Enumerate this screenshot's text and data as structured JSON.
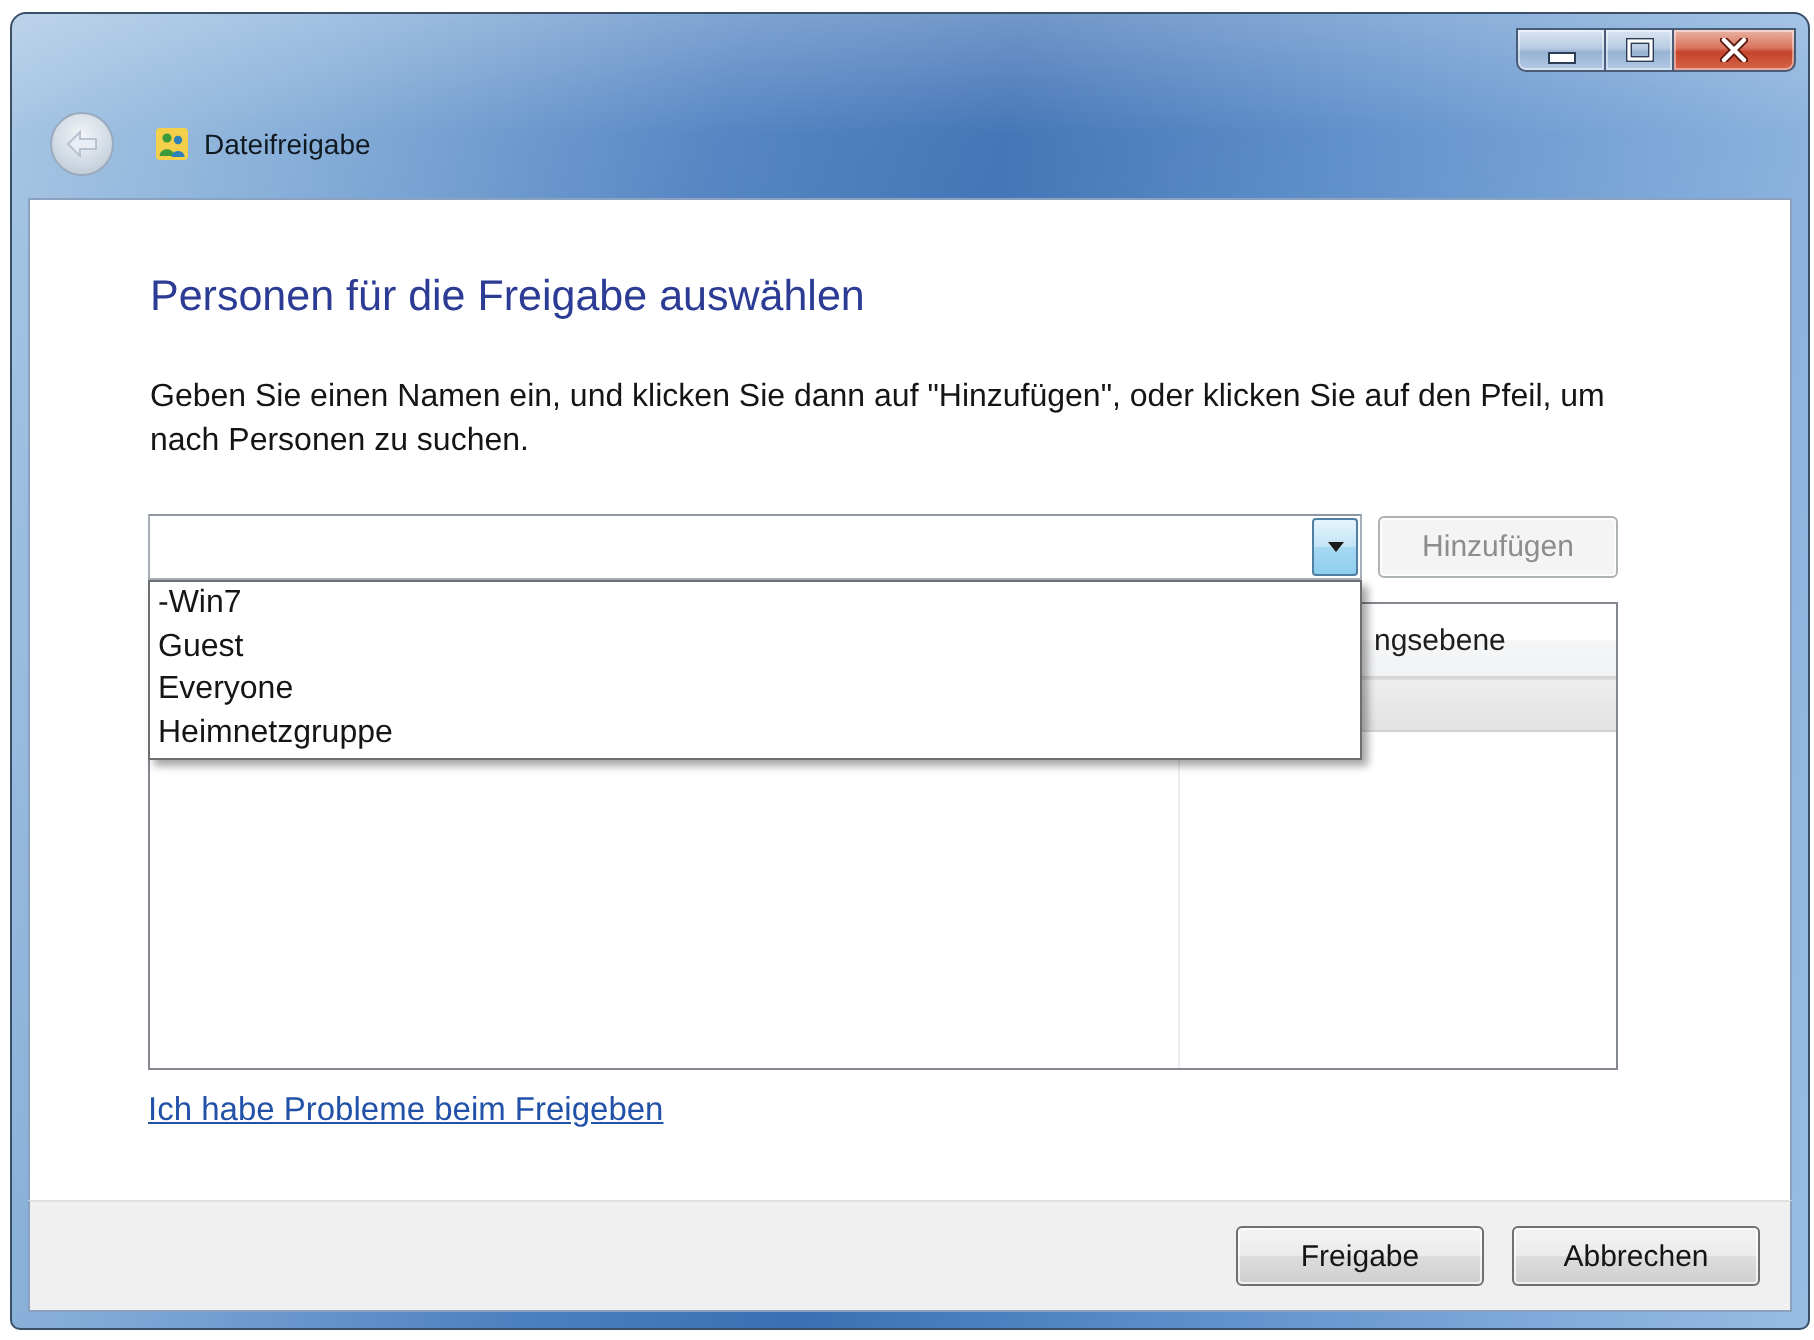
{
  "window": {
    "title": "Dateifreigabe",
    "back_enabled": false
  },
  "heading": "Personen für die Freigabe auswählen",
  "instruction": "Geben Sie einen Namen ein, und klicken Sie dann auf \"Hinzufügen\", oder klicken Sie auf den Pfeil, um nach Personen zu suchen.",
  "name_field": {
    "expanded": true,
    "options": [
      {
        "label": "-Win7",
        "selected": false
      },
      {
        "label": "Guest",
        "selected": false
      },
      {
        "label": "Everyone",
        "selected": false
      },
      {
        "label": "Heimnetzgruppe",
        "selected": false
      }
    ]
  },
  "add_button": {
    "label": "Hinzufügen",
    "disabled": true
  },
  "access_list": {
    "column_2": {
      "heading": "ngsebene"
    },
    "rows": [
      {
        "selected": true
      }
    ]
  },
  "help_link": "Ich habe Probleme beim Freigeben",
  "buttons": [
    {
      "label": "Freigabe"
    },
    {
      "label": "Abbrechen"
    }
  ]
}
